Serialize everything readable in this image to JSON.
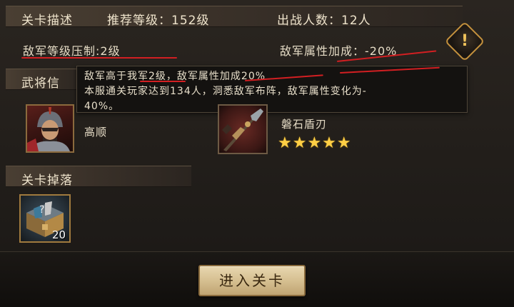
{
  "stage": {
    "section_title": "关卡描述",
    "recommended_level": "推荐等级：152级",
    "battle_count": "出战人数：12人",
    "level_suppression": "敌军等级压制:2级",
    "attribute_bonus": "敌军属性加成：-20%"
  },
  "tooltip": {
    "line1": "敌军高于我军2级，敌军属性加成20%",
    "line2": "本服通关玩家达到134人，洞悉敌军布阵，敌军属性变化为-",
    "line3": "40%。"
  },
  "generals": {
    "section_title": "武将信",
    "general_name": "高顺",
    "item_name": "磐石盾刃",
    "item_stars": "★★★★★",
    "item_star_count": 5
  },
  "drops": {
    "section_title": "关卡掉落",
    "count": "20"
  },
  "actions": {
    "enter_label": "进入关卡"
  },
  "icons": {
    "warning": "exclamation-diamond-icon",
    "portrait": "general-portrait",
    "item": "spear-weapon-icon",
    "drop": "treasure-chest-icon"
  },
  "colors": {
    "accent_gold": "#c4913d",
    "annotation_red": "#d21f22",
    "star": "#ffcf45"
  }
}
